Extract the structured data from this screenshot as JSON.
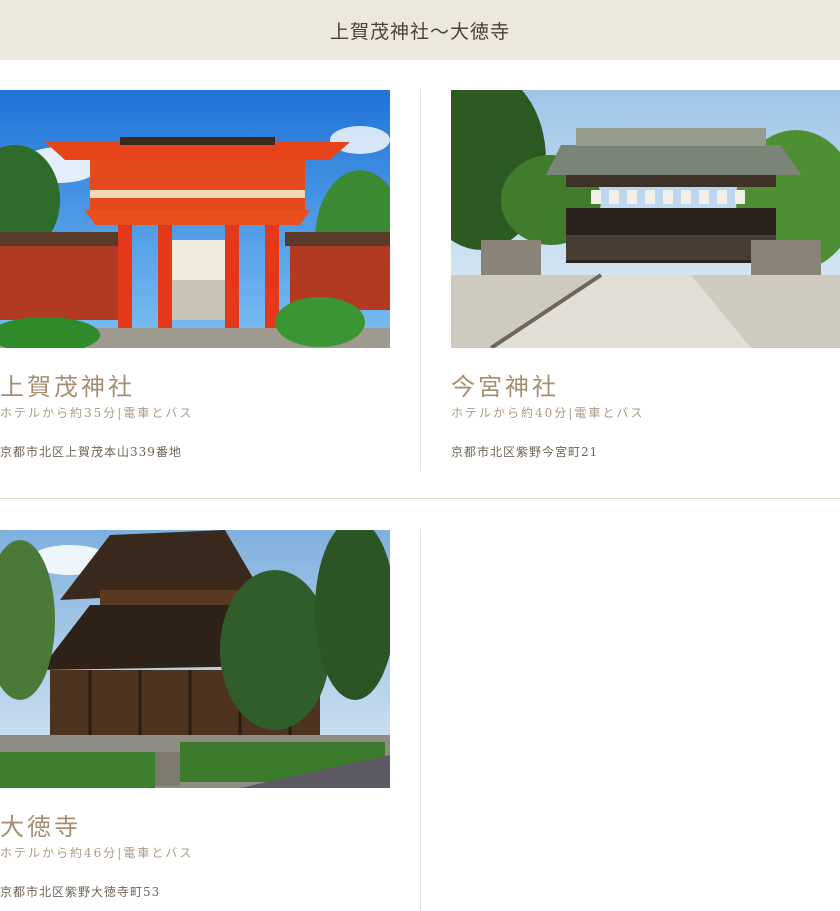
{
  "header": {
    "title": "上賀茂神社～大徳寺"
  },
  "cards": [
    {
      "name": "上賀茂神社",
      "access": "ホテルから約35分|電車とバス",
      "address": "京都市北区上賀茂本山339番地",
      "photo_icon": "vermilion-shrine-gate-photo"
    },
    {
      "name": "今宮神社",
      "access": "ホテルから約40分|電車とバス",
      "address": "京都市北区紫野今宮町21",
      "photo_icon": "shrine-hall-with-lanterns-photo"
    },
    {
      "name": "大徳寺",
      "access": "ホテルから約46分|電車とバス",
      "address": "京都市北区紫野大徳寺町53",
      "photo_icon": "wooden-temple-hall-photo"
    }
  ],
  "colors": {
    "header_bg": "#ede8de",
    "name": "#a58e72",
    "access": "#a99a85",
    "address": "#6e6455",
    "divider": "#ddd6c8"
  }
}
